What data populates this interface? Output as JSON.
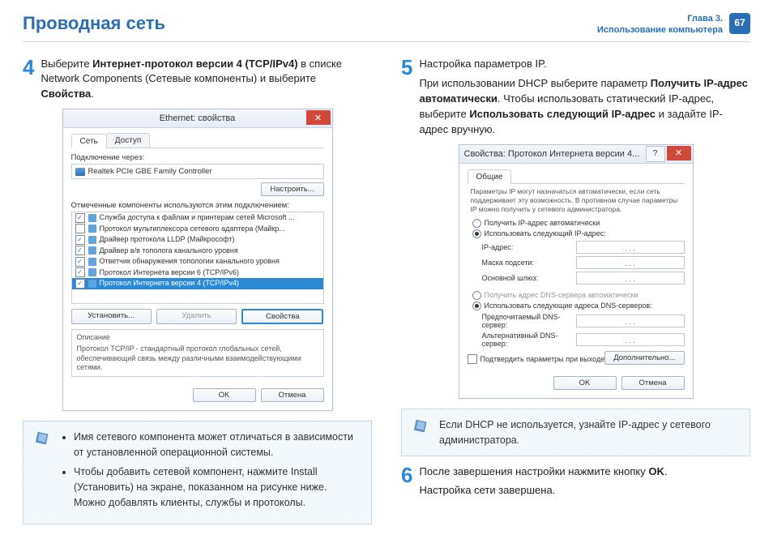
{
  "header": {
    "title": "Проводная сеть",
    "chapter_line1": "Глава 3.",
    "chapter_line2": "Использование компьютера",
    "page_number": "67"
  },
  "left": {
    "step4": {
      "num": "4",
      "text_before": "Выберите ",
      "bold1": "Интернет-протокол версии 4 (TCP/IPv4)",
      "text_mid": " в списке Network Components (Сетевые компоненты) и выберите ",
      "bold2": "Свойства",
      "text_after": "."
    },
    "dialog": {
      "title": "Ethernet: свойства",
      "tab_net": "Сеть",
      "tab_access": "Доступ",
      "conn_label": "Подключение через:",
      "adapter": "Realtek PCIe GBE Family Controller",
      "btn_configure": "Настроить...",
      "components_label": "Отмеченные компоненты используются этим подключением:",
      "items": [
        {
          "checked": true,
          "label": "Служба доступа к файлам и принтерам сетей Microsoft ..."
        },
        {
          "checked": false,
          "label": "Протокол мультиплексора сетевого адаптера (Майкр..."
        },
        {
          "checked": true,
          "label": "Драйвер протокола LLDP (Майкрософт)"
        },
        {
          "checked": true,
          "label": "Драйвер в/в тополога канального уровня"
        },
        {
          "checked": true,
          "label": "Ответчик обнаружения топологии канального уровня"
        },
        {
          "checked": true,
          "label": "Протокол Интернета версии 6 (TCP/IPv6)"
        },
        {
          "checked": true,
          "label": "Протокол Интернета версии 4 (TCP/IPv4)",
          "selected": true
        }
      ],
      "btn_install": "Установить...",
      "btn_remove": "Удалить",
      "btn_props": "Свойства",
      "desc_title": "Описание",
      "desc_text": "Протокол TCP/IP - стандартный протокол глобальных сетей, обеспечивающий связь между различными взаимодействующими сетями.",
      "btn_ok": "OK",
      "btn_cancel": "Отмена"
    },
    "note": {
      "bullet1": "Имя сетевого компонента может отличаться в зависимости от установленной операционной системы.",
      "bullet2": "Чтобы добавить сетевой компонент, нажмите Install (Установить) на экране, показанном на рисунке ниже. Можно добавлять клиенты, службы и протоколы."
    }
  },
  "right": {
    "step5": {
      "num": "5",
      "line1": "Настройка параметров IP.",
      "p_before": "При использовании DHCP выберите параметр  ",
      "b1": "Получить IP-адрес автоматически",
      "p_mid": ". Чтобы использовать статический IP-адрес, выберите ",
      "b2": "Использовать следующий IP-адрес",
      "p_after": " и задайте IP-адрес вручную."
    },
    "dialog": {
      "title": "Свойства: Протокол Интернета версии 4...",
      "tab_general": "Общие",
      "help": "Параметры IP могут назначаться автоматически, если сеть поддерживает эту возможность. В противном случае параметры IP можно получить у сетевого администратора.",
      "r_auto_ip": "Получить IP-адрес автоматически",
      "r_use_ip": "Использовать следующий IP-адрес:",
      "f_ip": "IP-адрес:",
      "f_mask": "Маска подсети:",
      "f_gw": "Основной шлюз:",
      "r_auto_dns": "Получить адрес DNS-сервера автоматически",
      "r_use_dns": "Использовать следующие адреса DNS-серверов:",
      "f_dns1": "Предпочитаемый DNS-сервер:",
      "f_dns2": "Альтернативный DNS-сервер:",
      "chk_confirm": "Подтвердить параметры при выходе",
      "btn_adv": "Дополнительно...",
      "btn_ok": "OK",
      "btn_cancel": "Отмена"
    },
    "note": {
      "text": "Если DHCP не используется, узнайте IP-адрес у сетевого администратора."
    },
    "step6": {
      "num": "6",
      "text_before": "После завершения настройки нажмите кнопку ",
      "bold": "OK",
      "text_after": ".",
      "line2": "Настройка сети завершена."
    }
  }
}
